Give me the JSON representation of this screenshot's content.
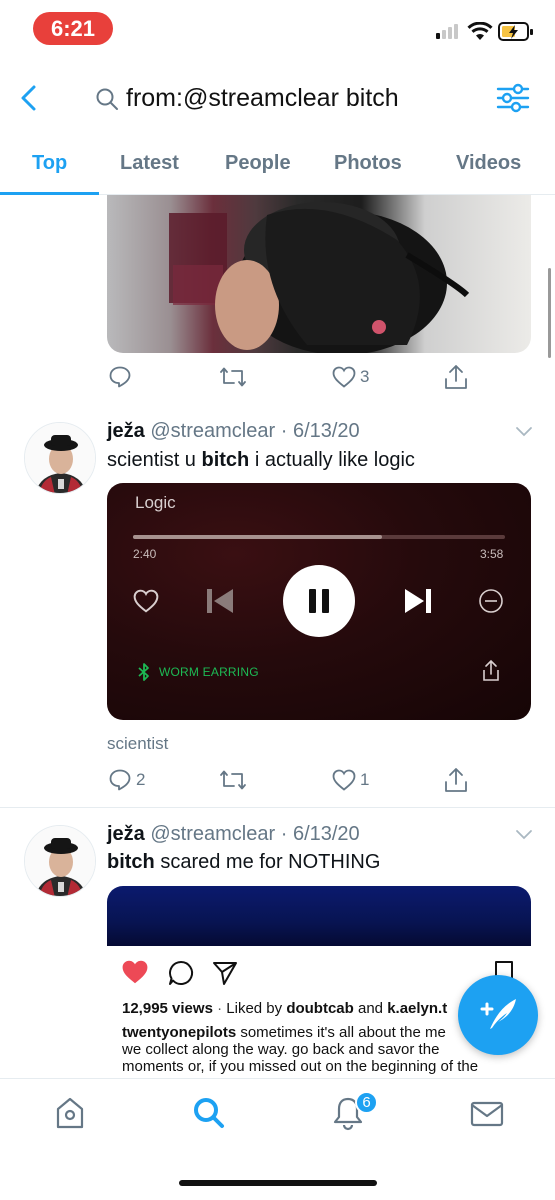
{
  "status_bar": {
    "time": "6:21"
  },
  "header": {
    "search_query": "from:@streamclear bitch",
    "tabs": [
      {
        "label": "Top",
        "active": true
      },
      {
        "label": "Latest"
      },
      {
        "label": "People"
      },
      {
        "label": "Photos"
      },
      {
        "label": "Videos"
      }
    ]
  },
  "tweet0": {
    "like_count": "3"
  },
  "tweet1": {
    "name": "ježa",
    "handle": "@streamclear",
    "date": "6/13/20",
    "text_pre": "scientist u ",
    "text_bold": "bitch",
    "text_post": " i actually like logic",
    "player": {
      "track": "Logic",
      "elapsed": "2:40",
      "total": "3:58",
      "progress": 0.67,
      "device": "WORM EARRING"
    },
    "caption": "scientist",
    "reply_count": "2",
    "like_count": "1"
  },
  "tweet2": {
    "name": "ježa",
    "handle": "@streamclear",
    "date": "6/13/20",
    "text_bold": "bitch",
    "text_post": " scared me for NOTHING",
    "insta": {
      "views": "12,995 views",
      "liked_by_pre": "Liked by ",
      "liked_by_1": "doubtcab",
      "liked_by_and": " and ",
      "liked_by_2": "k.aelyn.t",
      "cap_user": "twentyonepilots",
      "cap_line1": " sometimes it's all about the me",
      "cap_line2": "we collect along the way. go back and savor the",
      "cap_line3": "moments or, if you missed out on the beginning of the"
    }
  },
  "bottom_nav": {
    "notifications_badge": "6"
  },
  "colors": {
    "accent": "#1da1f2",
    "status_pill": "#e8403b",
    "like_red": "#ed4956",
    "spotify_green": "#1db954"
  }
}
